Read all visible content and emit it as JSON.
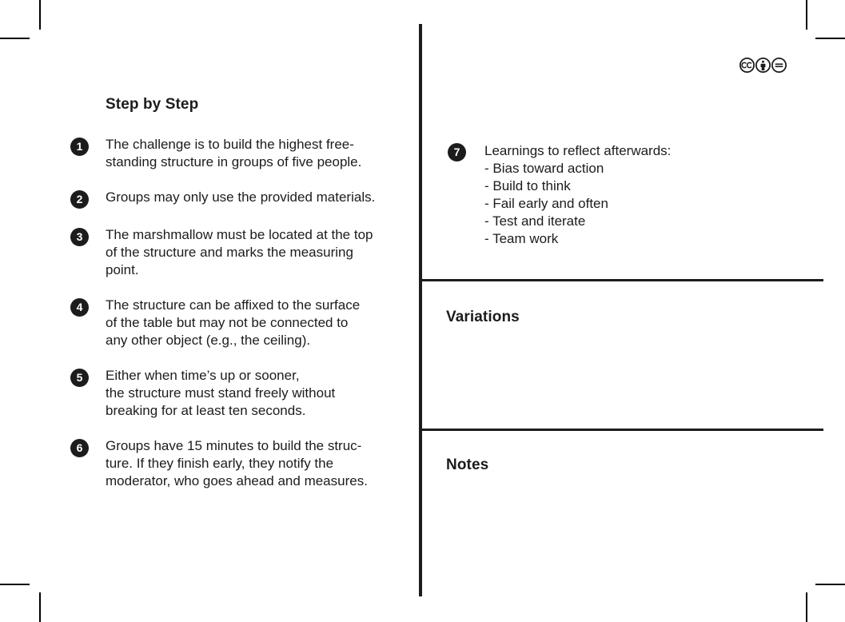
{
  "document": {
    "left_column": {
      "title": "Step by Step",
      "steps": [
        {
          "number": "1",
          "text": "The challenge is to build the highest free-\nstanding structure in groups of five people."
        },
        {
          "number": "2",
          "text": "Groups may only use the provided materials."
        },
        {
          "number": "3",
          "text": "The marshmallow must be located at the top\nof the structure and marks the measuring\npoint."
        },
        {
          "number": "4",
          "text": "The structure can be affixed to the surface\nof the table but may not be connected to\nany other object (e.g., the ceiling)."
        },
        {
          "number": "5",
          "text": "Either when time’s up or sooner,\nthe structure must stand freely without\nbreaking for at least ten seconds."
        },
        {
          "number": "6",
          "text": "Groups have 15 minutes to build the struc-\nture. If they finish early, they notify the\nmoderator, who goes ahead and measures."
        }
      ]
    },
    "right_column": {
      "steps": [
        {
          "number": "7",
          "text": "Learnings to reflect afterwards:\n- Bias toward action\n- Build to think\n- Fail early and often\n- Test and iterate\n- Team work"
        }
      ]
    },
    "panels": {
      "variations_title": "Variations",
      "variations_body": "",
      "notes_title": "Notes",
      "notes_body": ""
    },
    "license": {
      "badges": [
        {
          "name": "creative-commons-icon",
          "label": "cc"
        },
        {
          "name": "attribution-icon",
          "label": "BY"
        },
        {
          "name": "no-derivatives-icon",
          "label": "ND"
        }
      ]
    },
    "colors": {
      "ink": "#1c1c1c",
      "paper": "#ffffff",
      "crop_mark": "#000000"
    }
  }
}
